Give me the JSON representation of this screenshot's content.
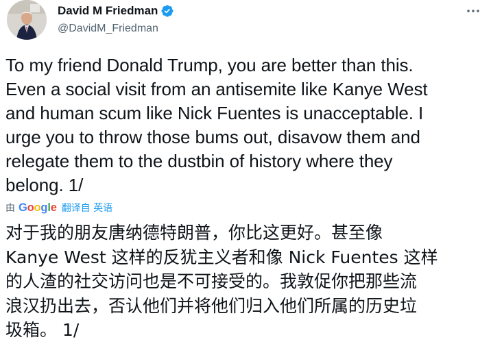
{
  "author": {
    "display_name": "David M Friedman",
    "handle": "@DavidM_Friedman",
    "verified": true,
    "verified_color": "#1d9bf0"
  },
  "tweet": {
    "text_lines": [
      "To my friend Donald Trump, you are better than this.",
      "Even a social visit from an antisemite like Kanye West",
      "and human scum like Nick Fuentes is unacceptable. I",
      "urge you to throw those bums out, disavow them and",
      "relegate them to the dustbin of history where they",
      "belong. 1/"
    ]
  },
  "translation": {
    "by_label": "由",
    "provider": "Google",
    "translated_from_label": "翻译自 英语",
    "text_lines": [
      "对于我的朋友唐纳德特朗普，你比这更好。甚至像",
      "Kanye West 这样的反犹主义者和像 Nick Fuentes 这样",
      "的人渣的社交访问也是不可接受的。我敦促你把那些流",
      "浪汉扔出去，否认他们并将他们归入他们所属的历史垃",
      "圾箱。 1/"
    ]
  },
  "icons": {
    "more": "more-options-icon",
    "verified": "verified-badge-icon"
  }
}
